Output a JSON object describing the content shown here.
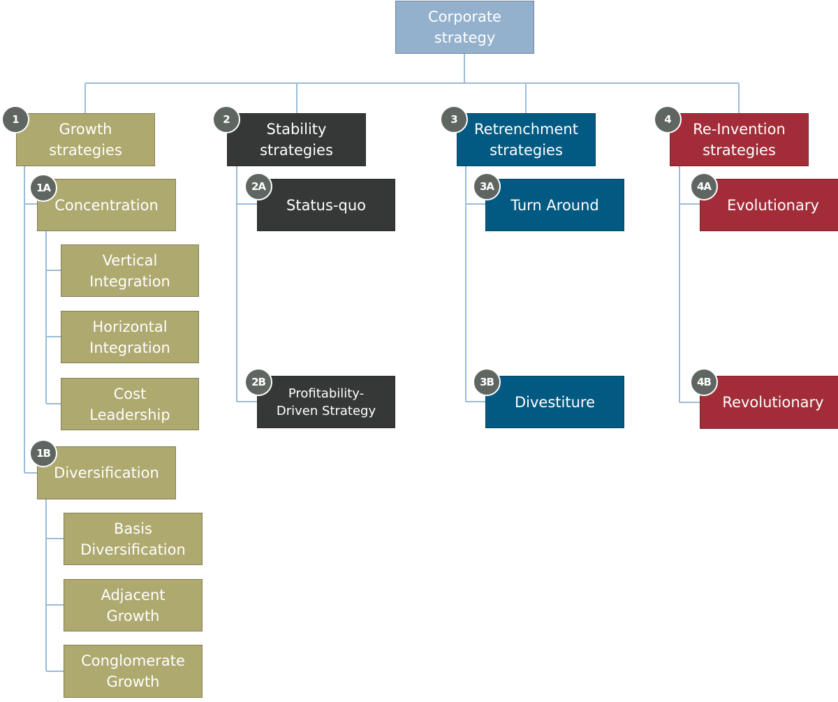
{
  "colors": {
    "root": "#93b1cc",
    "growth": "#aea96f",
    "stability": "#363837",
    "retrenchment": "#025a82",
    "reinvention": "#a22d38",
    "connector": "#9bbbd8",
    "badge": "#5f6662"
  },
  "root": {
    "label": "Corporate\nstrategy"
  },
  "branches": [
    {
      "id": "growth",
      "badge": "1",
      "label": "Growth\nstrategies",
      "children": [
        {
          "badge": "1A",
          "label": "Concentration",
          "children": [
            {
              "label": "Vertical\nIntegration"
            },
            {
              "label": "Horizontal\nIntegration"
            },
            {
              "label": "Cost\nLeadership"
            }
          ]
        },
        {
          "badge": "1B",
          "label": "Diversification",
          "children": [
            {
              "label": "Basis\nDiversification"
            },
            {
              "label": "Adjacent\nGrowth"
            },
            {
              "label": "Conglomerate\nGrowth"
            }
          ]
        }
      ]
    },
    {
      "id": "stability",
      "badge": "2",
      "label": "Stability\nstrategies",
      "children": [
        {
          "badge": "2A",
          "label": "Status-quo"
        },
        {
          "badge": "2B",
          "label": "Profitability-\nDriven Strategy"
        }
      ]
    },
    {
      "id": "retrenchment",
      "badge": "3",
      "label": "Retrenchment\nstrategies",
      "children": [
        {
          "badge": "3A",
          "label": "Turn Around"
        },
        {
          "badge": "3B",
          "label": "Divestiture"
        }
      ]
    },
    {
      "id": "reinvention",
      "badge": "4",
      "label": "Re-Invention\nstrategies",
      "children": [
        {
          "badge": "4A",
          "label": "Evolutionary"
        },
        {
          "badge": "4B",
          "label": "Revolutionary"
        }
      ]
    }
  ]
}
